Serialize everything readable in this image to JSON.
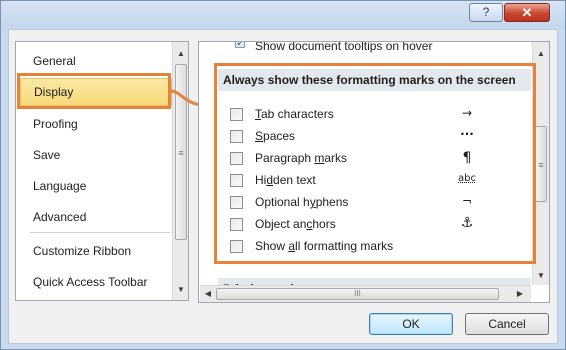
{
  "titlebar": {
    "help_label": "?",
    "close_label": "✕"
  },
  "nav": {
    "items": [
      {
        "label": "General",
        "selected": false
      },
      {
        "label": "Display",
        "selected": true
      },
      {
        "label": "Proofing",
        "selected": false
      },
      {
        "label": "Save",
        "selected": false
      },
      {
        "label": "Language",
        "selected": false
      },
      {
        "label": "Advanced",
        "selected": false
      },
      {
        "label": "Customize Ribbon",
        "selected": false
      },
      {
        "label": "Quick Access Toolbar",
        "selected": false
      }
    ]
  },
  "content": {
    "clipped_option": "Show document tooltips on hover",
    "section_title": "Always show these formatting marks on the screen",
    "options": [
      {
        "pre": "",
        "accel": "T",
        "post": "ab characters",
        "symbol": "→",
        "checked": false
      },
      {
        "pre": "",
        "accel": "S",
        "post": "paces",
        "symbol": "···",
        "checked": false
      },
      {
        "pre": "Paragraph ",
        "accel": "m",
        "post": "arks",
        "symbol": "¶",
        "checked": false
      },
      {
        "pre": "Hi",
        "accel": "d",
        "post": "den text",
        "symbol": "abc",
        "checked": false
      },
      {
        "pre": "Optional h",
        "accel": "y",
        "post": "phens",
        "symbol": "¬",
        "checked": false
      },
      {
        "pre": "Object an",
        "accel": "c",
        "post": "hors",
        "symbol": "⚓",
        "checked": false
      },
      {
        "pre": "Show ",
        "accel": "a",
        "post": "ll formatting marks",
        "symbol": "",
        "checked": false
      }
    ],
    "next_section_title": "Printing options"
  },
  "scroll": {
    "up": "▲",
    "down": "▼",
    "left": "◀",
    "right": "▶",
    "grip_v": "≡",
    "grip_h": "III"
  },
  "footer": {
    "ok_label": "OK",
    "cancel_label": "Cancel"
  },
  "colors": {
    "highlight": "#e8823a",
    "selection": "#f7d97b"
  }
}
